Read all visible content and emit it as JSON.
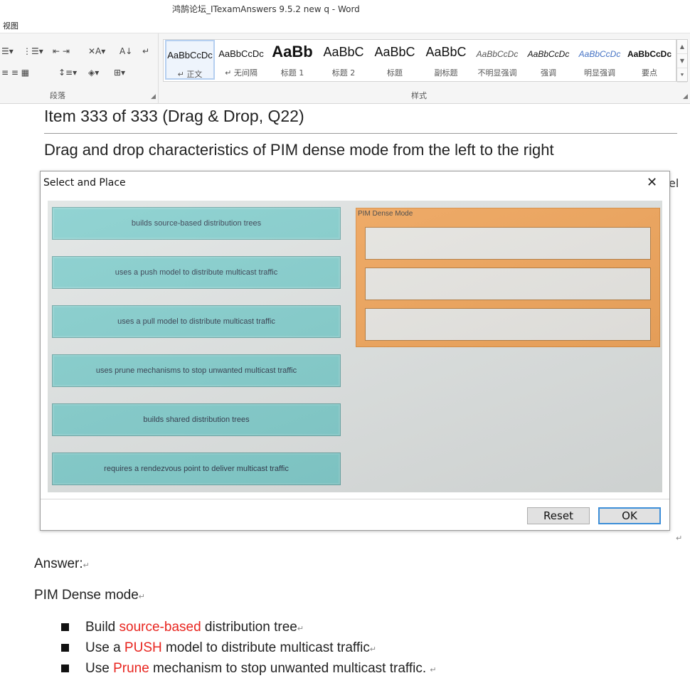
{
  "window": {
    "title": "鸿鹄论坛_ITexamAnswers 9.5.2 new q - Word"
  },
  "menu": {
    "view": "视图"
  },
  "ribbon": {
    "paragraph_label": "段落",
    "styles_label": "样式",
    "styles": [
      {
        "preview": "AaBbCcDc",
        "name": "↵ 正文"
      },
      {
        "preview": "AaBbCcDc",
        "name": "↵ 无间隔"
      },
      {
        "preview": "AaBb",
        "name": "标题 1"
      },
      {
        "preview": "AaBbC",
        "name": "标题 2"
      },
      {
        "preview": "AaBbC",
        "name": "标题"
      },
      {
        "preview": "AaBbC",
        "name": "副标题"
      },
      {
        "preview": "AaBbCcDc",
        "name": "不明显强调"
      },
      {
        "preview": "AaBbCcDc",
        "name": "强调"
      },
      {
        "preview": "AaBbCcDc",
        "name": "明显强调"
      },
      {
        "preview": "AaBbCcDc",
        "name": "要点"
      }
    ]
  },
  "document": {
    "item_title": "Item 333 of 333  (Drag & Drop, Q22)",
    "instruction": "Drag and drop characteristics of PIM dense mode from the left to the right",
    "peek_text": "el"
  },
  "dialog": {
    "title": "Select and Place",
    "drag_items": [
      "builds source-based distribution trees",
      "uses a push model to distribute multicast traffic",
      "uses a pull model to distribute multicast traffic",
      "uses prune mechanisms to stop unwanted multicast traffic",
      "builds shared distribution trees",
      "requires a rendezvous point to deliver multicast traffic"
    ],
    "drop_header": "PIM Dense Mode",
    "reset_label": "Reset",
    "ok_label": "OK"
  },
  "answer": {
    "label": "Answer:",
    "heading": "PIM Dense mode",
    "bullets": [
      {
        "pre": "Build ",
        "highlight": "source-based",
        "post": " distribution tree"
      },
      {
        "pre": "Use a ",
        "highlight": "PUSH",
        "post": " model to distribute multicast traffic"
      },
      {
        "pre": "Use ",
        "highlight": "Prune",
        "post": " mechanism to stop unwanted multicast traffic. "
      }
    ]
  },
  "colors": {
    "drag_item": "#7fcccb",
    "drop_panel": "#f1a356",
    "answer_highlight": "#e8251f",
    "ok_border": "#3c8ed8"
  }
}
